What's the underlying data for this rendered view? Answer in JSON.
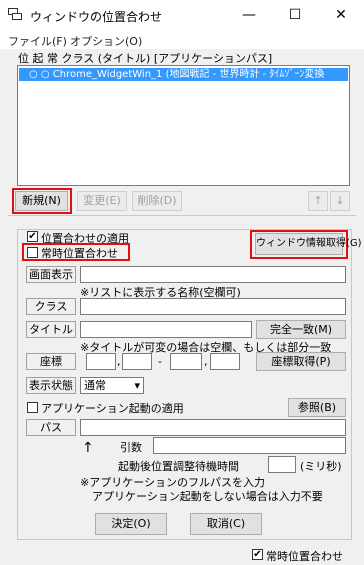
{
  "window": {
    "title": "ウィンドウの位置合わせ",
    "minimize_glyph": "—",
    "maximize_glyph": "☐",
    "close_glyph": "✕"
  },
  "menu": [
    {
      "label": "ファイル(F)"
    },
    {
      "label": "オプション(O)"
    }
  ],
  "list": {
    "column_header": "位 起 常 クラス (タイトル) [アプリケーションパス]",
    "selected_row_text": "○  ○ Chrome_WidgetWin_1 (地図戦記 - 世界時計 - ﾀｲﾑｿﾞｰﾝ変換"
  },
  "list_buttons": {
    "new": "新規(N)",
    "edit": "変更(E)",
    "delete": "削除(D)",
    "up": "↑",
    "down": "↓"
  },
  "options": {
    "apply_position": {
      "label": "位置合わせの適用",
      "checked": true
    },
    "always_position": {
      "label": "常時位置合わせ",
      "checked": false
    },
    "get_window_info_button": "ウィンドウ情報取得(G)"
  },
  "form": {
    "display_name_label": "画面表示",
    "display_name_note": "※リストに表示する名称(空欄可)",
    "class_label": "クラス",
    "title_label": "タイトル",
    "exact_match_button": "完全一致(M)",
    "title_note": "※タイトルが可変の場合は空欄、もしくは部分一致",
    "coords_label": "座標",
    "coord_sep_comma": ",",
    "coord_sep_dash": "-",
    "get_coords_button": "座標取得(P)",
    "display_state_label": "表示状態",
    "display_state_value": "通常",
    "apply_app_launch": {
      "label": "アプリケーション起動の適用",
      "checked": false
    },
    "browse_button": "参照(B)",
    "path_label": "パス",
    "args_label": "引数",
    "wait_label": "起動後位置調整待機時間",
    "wait_unit": "(ミリ秒)",
    "arrow": "↑",
    "app_note_1": "※アプリケーションのフルパスを入力",
    "app_note_2": "アプリケーション起動をしない場合は入力不要",
    "ok_button": "決定(O)",
    "cancel_button": "取消(C)"
  },
  "statusbar": {
    "always_position": {
      "label": "常時位置合わせ",
      "checked": true
    }
  }
}
